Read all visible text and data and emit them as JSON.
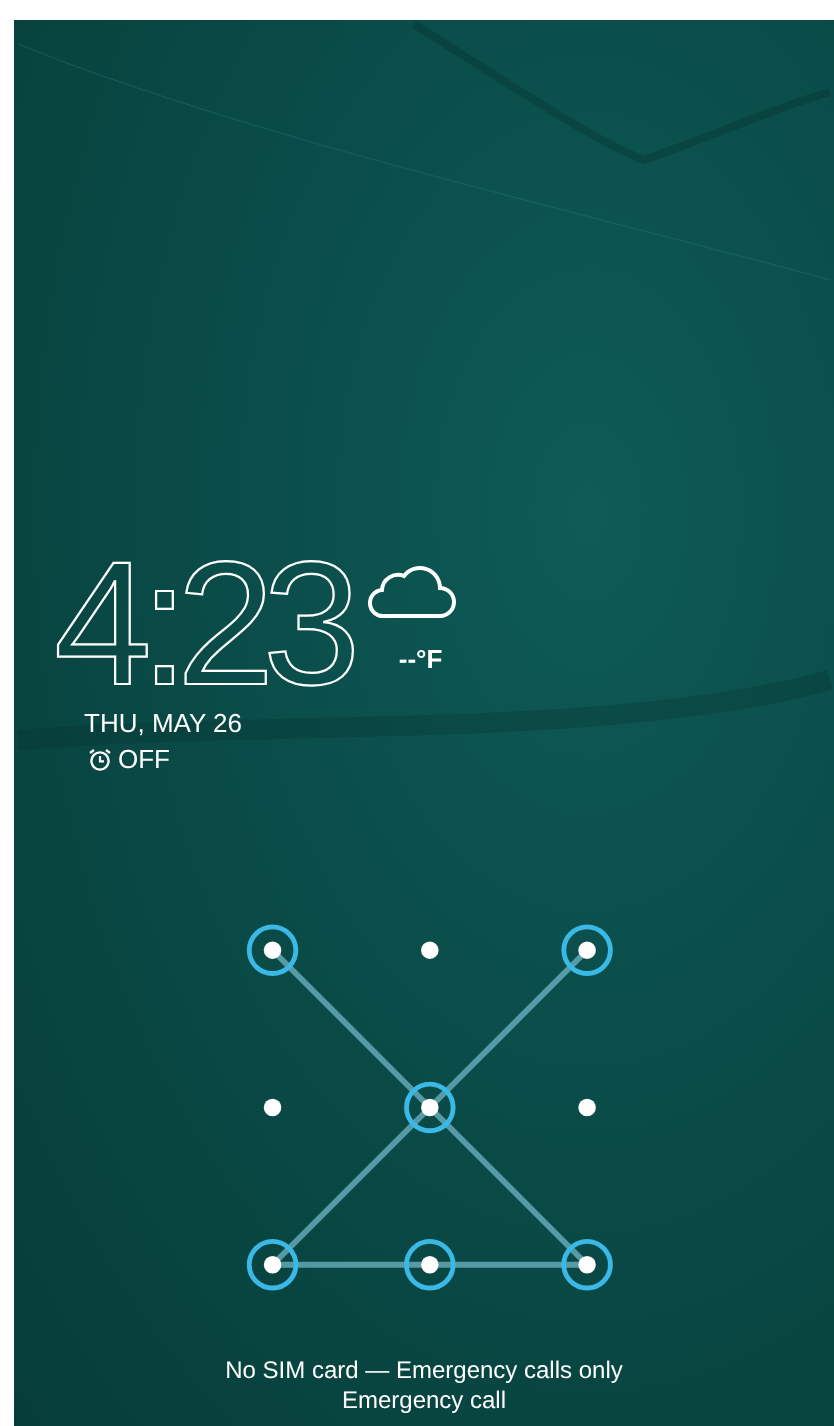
{
  "clock": {
    "time": "4:23",
    "temperature": "--°F",
    "date": "THU, MAY 26",
    "alarm": "OFF"
  },
  "pattern": {
    "dots": [
      {
        "selected": true
      },
      {
        "selected": false
      },
      {
        "selected": true
      },
      {
        "selected": false
      },
      {
        "selected": true
      },
      {
        "selected": false
      },
      {
        "selected": true
      },
      {
        "selected": true
      },
      {
        "selected": true
      }
    ]
  },
  "status": {
    "message": "No SIM card — Emergency calls only",
    "emergency_button": "Emergency call"
  }
}
